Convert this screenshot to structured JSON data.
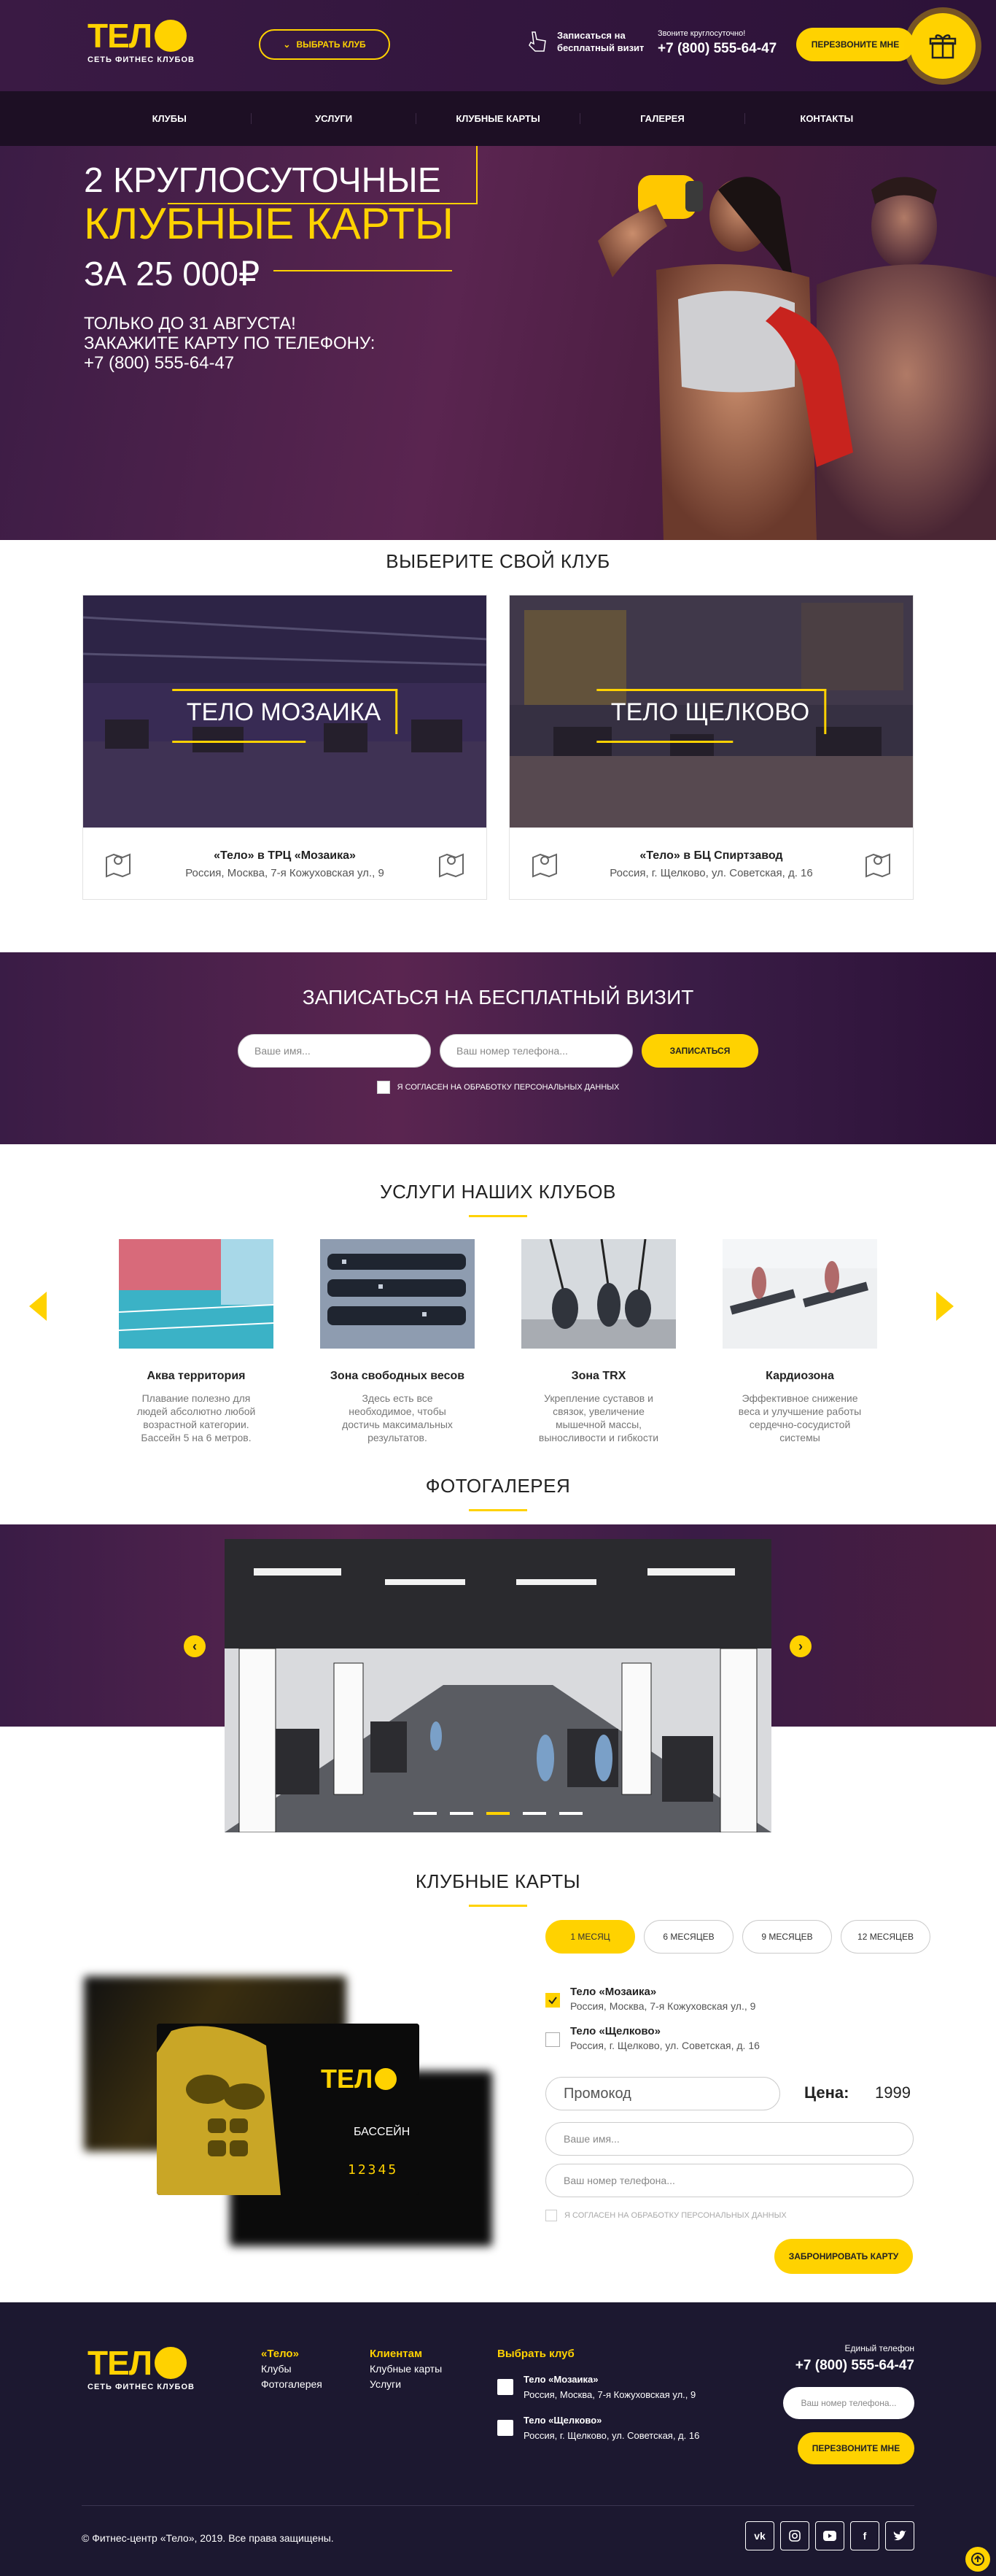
{
  "header": {
    "logo_text": "ТЕЛ",
    "logo_sub": "СЕТЬ ФИТНЕС КЛУБОВ",
    "select_club": "ВЫБРАТЬ КЛУБ",
    "visit_text": "Записаться на бесплатный визит",
    "phone_label": "Звоните круглосуточно!",
    "phone": "+7 (800) 555-64-47",
    "callback": "ПЕРЕЗВОНИТЕ МНЕ"
  },
  "nav": [
    "КЛУБЫ",
    "УСЛУГИ",
    "КЛУБНЫЕ КАРТЫ",
    "ГАЛЕРЕЯ",
    "КОНТАКТЫ"
  ],
  "hero": {
    "line1": "2 КРУГЛОСУТОЧНЫЕ",
    "line2": "КЛУБНЫЕ КАРТЫ",
    "line3": "ЗА 25 000₽",
    "promo1": "ТОЛЬКО ДО 31 АВГУСТА!",
    "promo2": "ЗАКАЖИТЕ КАРТУ ПО ТЕЛЕФОНУ:",
    "promo3": "+7 (800) 555-64-47"
  },
  "clubs": {
    "title": "ВЫБЕРИТЕ СВОЙ КЛУБ",
    "items": [
      {
        "name": "ТЕЛО МОЗАИКА",
        "title": "«Тело» в ТРЦ «Мозаика»",
        "address": "Россия, Москва, 7-я Кожуховская ул., 9"
      },
      {
        "name": "ТЕЛО ЩЕЛКОВО",
        "title": "«Тело» в БЦ Спиртзавод",
        "address": "Россия, г. Щелково, ул. Советская, д. 16"
      }
    ]
  },
  "free_visit": {
    "title": "ЗАПИСАТЬСЯ НА БЕСПЛАТНЫЙ ВИЗИТ",
    "name_placeholder": "Ваше имя...",
    "phone_placeholder": "Ваш номер телефона...",
    "submit": "ЗАПИСАТЬСЯ",
    "agree": "Я СОГЛАСЕН НА ОБРАБОТКУ ПЕРСОНАЛЬНЫХ ДАННЫХ"
  },
  "services": {
    "title": "УСЛУГИ НАШИХ КЛУБОВ",
    "items": [
      {
        "title": "Аква территория",
        "desc": "Плавание полезно для людей абсолютно любой возрастной категории. Бассейн 5 на 6 метров."
      },
      {
        "title": "Зона свободных весов",
        "desc": "Здесь есть все необходимое, чтобы достичь максимальных результатов."
      },
      {
        "title": "Зона TRX",
        "desc": "Укрепление суставов и связок, увеличение мышечной массы, выносливости и гибкости"
      },
      {
        "title": "Кардиозона",
        "desc": "Эффективное снижение веса и улучшение работы сердечно-сосудистой системы"
      }
    ]
  },
  "gallery": {
    "title": "ФОТОГАЛЕРЕЯ"
  },
  "cards": {
    "title": "КЛУБНЫЕ КАРТЫ",
    "tabs": [
      "1 МЕСЯЦ",
      "6 МЕСЯЦЕВ",
      "9 МЕСЯЦЕВ",
      "12 МЕСЯЦЕВ"
    ],
    "card_logo": "ТЕЛ",
    "card_label": "БАССЕЙН",
    "card_number": "12345",
    "clubs": [
      {
        "title": "Тело «Мозаика»",
        "address": "Россия, Москва, 7-я Кожуховская ул., 9"
      },
      {
        "title": "Тело «Щелково»",
        "address": "Россия, г. Щелково, ул. Советская, д. 16"
      }
    ],
    "promo_placeholder": "Промокод",
    "price_label": "Цена:",
    "price_value": "1999",
    "name_placeholder": "Ваше имя...",
    "phone_placeholder": "Ваш номер телефона...",
    "agree": "Я СОГЛАСЕН НА ОБРАБОТКУ ПЕРСОНАЛЬНЫХ ДАННЫХ",
    "book": "ЗАБРОНИРОВАТЬ КАРТУ"
  },
  "footer": {
    "col1_title": "«Тело»",
    "col1_links": [
      "Клубы",
      "Фотогалерея"
    ],
    "col2_title": "Клиентам",
    "col2_links": [
      "Клубные карты",
      "Услуги"
    ],
    "col3_title": "Выбрать клуб",
    "clubs": [
      {
        "title": "Тело «Мозаика»",
        "address": "Россия, Москва, 7-я Кожуховская ул., 9"
      },
      {
        "title": "Тело «Щелково»",
        "address": "Россия, г. Щелково, ул. Советская, д. 16"
      }
    ],
    "phone_label": "Единый телефон",
    "phone": "+7 (800) 555-64-47",
    "phone_placeholder": "Ваш номер телефона...",
    "callback": "ПЕРЕЗВОНИТЕ МНЕ",
    "copyright": "© Фитнес-центр «Тело», 2019. Все права защищены.",
    "social": [
      "vk",
      "instagram",
      "youtube",
      "facebook",
      "twitter"
    ]
  },
  "colors": {
    "accent": "#ffd200",
    "dark": "#2c1238",
    "footer": "#1c1830"
  }
}
